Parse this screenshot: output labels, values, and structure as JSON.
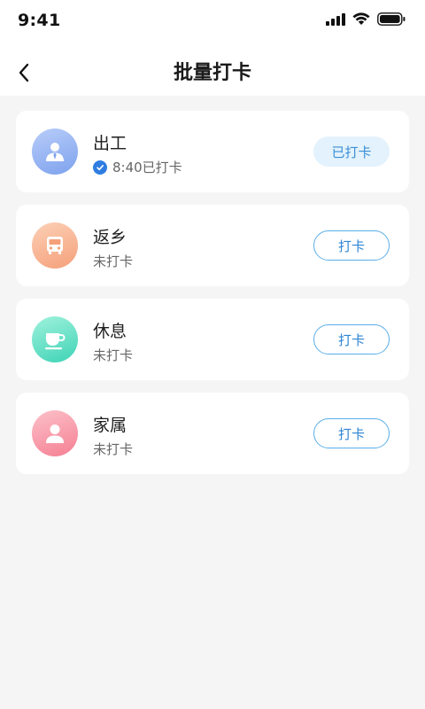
{
  "status_bar": {
    "time": "9:41",
    "icons": [
      "signal-icon",
      "wifi-icon",
      "battery-icon"
    ]
  },
  "header": {
    "title": "批量打卡",
    "back_icon": "chevron-left-icon"
  },
  "colors": {
    "accent": "#2f86d4",
    "done_button_bg": "#e3f2fc",
    "page_bg": "#f5f5f5"
  },
  "items": [
    {
      "name": "出工",
      "icon": "worker-icon",
      "status_checked": true,
      "status_text": "8:40已打卡",
      "button_label": "已打卡",
      "button_state": "done"
    },
    {
      "name": "返乡",
      "icon": "bus-icon",
      "status_checked": false,
      "status_text": "未打卡",
      "button_label": "打卡",
      "button_state": "todo"
    },
    {
      "name": "休息",
      "icon": "cup-icon",
      "status_checked": false,
      "status_text": "未打卡",
      "button_label": "打卡",
      "button_state": "todo"
    },
    {
      "name": "家属",
      "icon": "person-icon",
      "status_checked": false,
      "status_text": "未打卡",
      "button_label": "打卡",
      "button_state": "todo"
    }
  ]
}
